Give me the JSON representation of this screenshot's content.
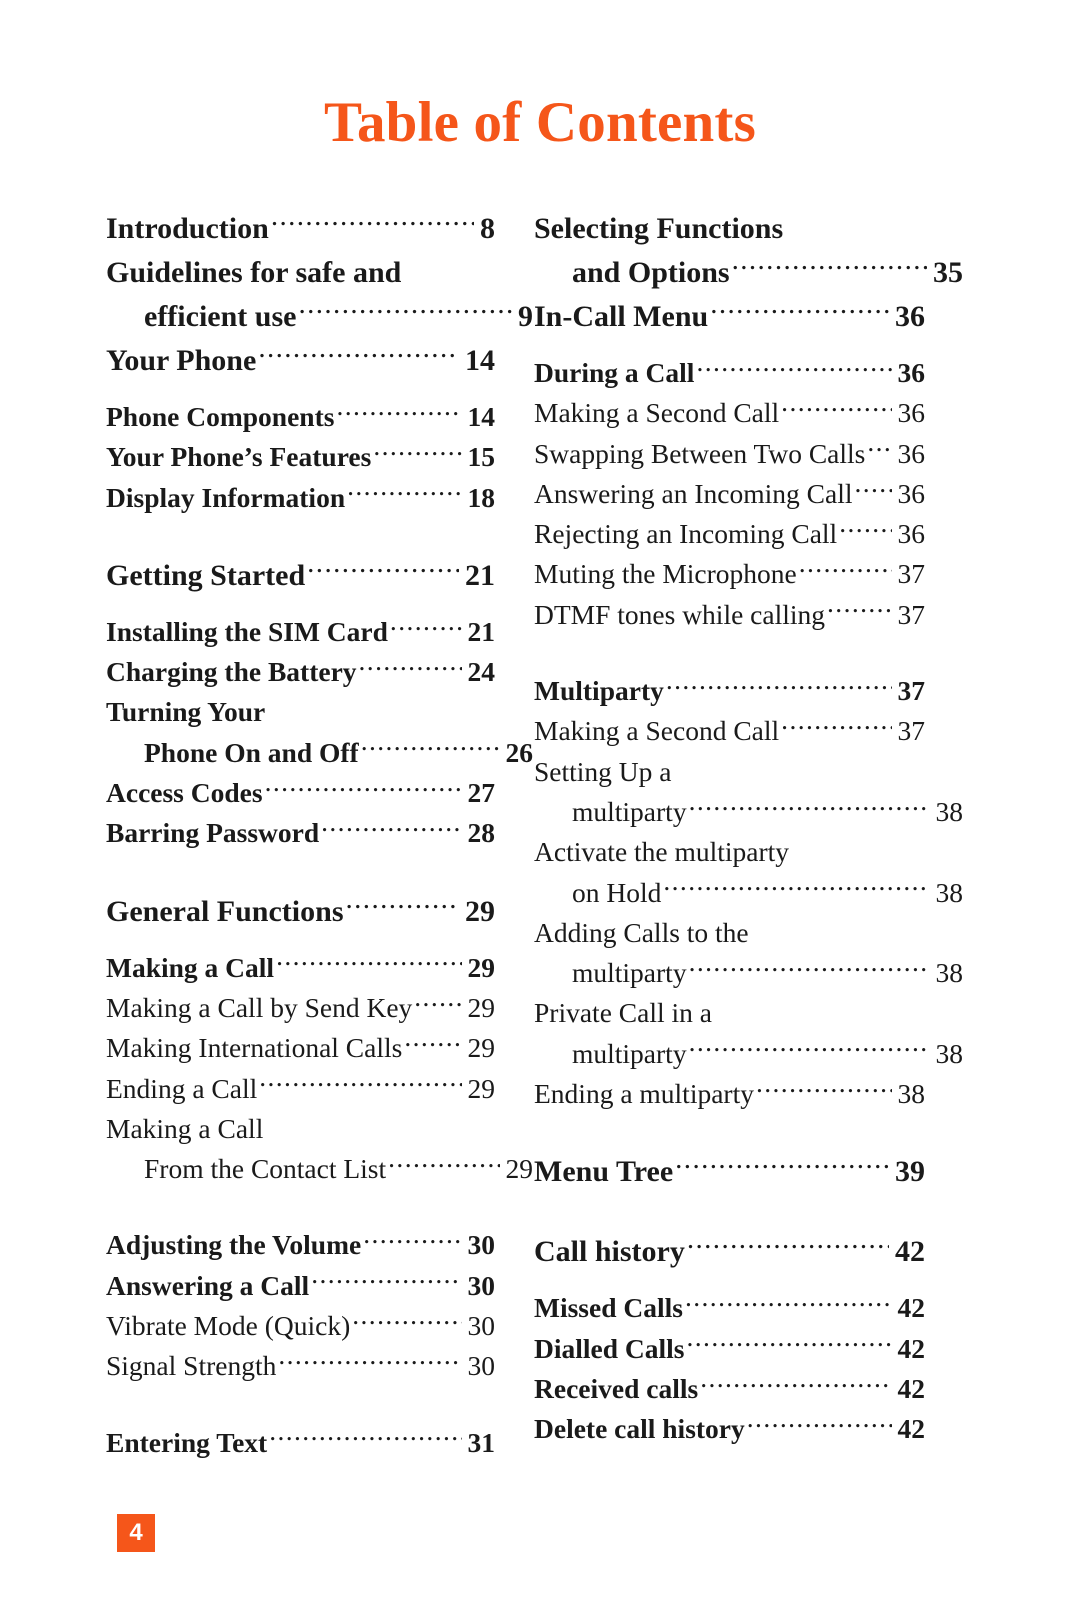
{
  "title": "Table of Contents",
  "accent_color": "#f5561a",
  "text_color": "#1a1a1a",
  "page_badge": {
    "number": "4"
  },
  "left_column": [
    {
      "label": "Introduction",
      "page": "8",
      "style": "head"
    },
    {
      "label": "Guidelines for safe and",
      "page": "",
      "style": "head-noleader"
    },
    {
      "label": "efficient use",
      "page": "9",
      "style": "head-indent"
    },
    {
      "label": "Your Phone",
      "page": "14",
      "style": "head"
    },
    {
      "label": "",
      "page": "",
      "style": "gap-sm"
    },
    {
      "label": "Phone Components",
      "page": "14",
      "style": "bold"
    },
    {
      "label": "Your Phone’s Features",
      "page": "15",
      "style": "bold"
    },
    {
      "label": "Display Information",
      "page": "18",
      "style": "bold"
    },
    {
      "label": "",
      "page": "",
      "style": "gap-lg"
    },
    {
      "label": "Getting Started",
      "page": "21",
      "style": "head"
    },
    {
      "label": "",
      "page": "",
      "style": "gap-sm"
    },
    {
      "label": "Installing the SIM Card",
      "page": "21",
      "style": "bold"
    },
    {
      "label": "Charging the Battery",
      "page": "24",
      "style": "bold"
    },
    {
      "label": "Turning Your",
      "page": "",
      "style": "bold-noleader"
    },
    {
      "label": "Phone On and Off",
      "page": "26",
      "style": "bold-indent"
    },
    {
      "label": "Access Codes",
      "page": "27",
      "style": "bold"
    },
    {
      "label": "Barring Password",
      "page": "28",
      "style": "bold"
    },
    {
      "label": "",
      "page": "",
      "style": "gap-lg"
    },
    {
      "label": "General Functions",
      "page": "29",
      "style": "head"
    },
    {
      "label": "",
      "page": "",
      "style": "gap-sm"
    },
    {
      "label": "Making a Call",
      "page": "29",
      "style": "bold"
    },
    {
      "label": "Making a Call by Send Key",
      "page": "29",
      "style": "regular"
    },
    {
      "label": "Making International Calls",
      "page": "29",
      "style": "regular"
    },
    {
      "label": "Ending a Call",
      "page": "29",
      "style": "regular"
    },
    {
      "label": "Making a Call",
      "page": "",
      "style": "regular-noleader"
    },
    {
      "label": "From the Contact List",
      "page": "29",
      "style": "regular-indent"
    },
    {
      "label": "",
      "page": "",
      "style": "gap-lg"
    },
    {
      "label": "Adjusting the Volume",
      "page": "30",
      "style": "bold"
    },
    {
      "label": "Answering a Call",
      "page": "30",
      "style": "bold"
    },
    {
      "label": "Vibrate Mode (Quick)",
      "page": "30",
      "style": "regular"
    },
    {
      "label": "Signal Strength",
      "page": "30",
      "style": "regular"
    },
    {
      "label": "",
      "page": "",
      "style": "gap-lg"
    },
    {
      "label": "Entering Text",
      "page": "31",
      "style": "bold"
    }
  ],
  "right_column": [
    {
      "label": "Selecting Functions",
      "page": "",
      "style": "head-noleader"
    },
    {
      "label": "and Options",
      "page": "35",
      "style": "head-indent"
    },
    {
      "label": "In-Call Menu",
      "page": "36",
      "style": "head"
    },
    {
      "label": "",
      "page": "",
      "style": "gap-sm"
    },
    {
      "label": "During a Call",
      "page": "36",
      "style": "bold"
    },
    {
      "label": "Making a Second Call",
      "page": "36",
      "style": "regular"
    },
    {
      "label": "Swapping Between Two Calls",
      "page": "36",
      "style": "regular"
    },
    {
      "label": "Answering an Incoming Call",
      "page": "36",
      "style": "regular"
    },
    {
      "label": "Rejecting an Incoming Call",
      "page": "36",
      "style": "regular"
    },
    {
      "label": "Muting the Microphone",
      "page": "37",
      "style": "regular"
    },
    {
      "label": "DTMF tones while calling",
      "page": "37",
      "style": "regular"
    },
    {
      "label": "",
      "page": "",
      "style": "gap-lg"
    },
    {
      "label": "Multiparty",
      "page": "37",
      "style": "bold"
    },
    {
      "label": "Making a Second Call",
      "page": "37",
      "style": "regular"
    },
    {
      "label": "Setting Up a",
      "page": "",
      "style": "regular-noleader"
    },
    {
      "label": "multiparty",
      "page": "38",
      "style": "regular-indent"
    },
    {
      "label": "Activate the multiparty",
      "page": "",
      "style": "regular-noleader"
    },
    {
      "label": "on Hold",
      "page": "38",
      "style": "regular-indent"
    },
    {
      "label": "Adding Calls to the",
      "page": "",
      "style": "regular-noleader"
    },
    {
      "label": "multiparty",
      "page": "38",
      "style": "regular-indent"
    },
    {
      "label": "Private Call in a",
      "page": "",
      "style": "regular-noleader"
    },
    {
      "label": "multiparty",
      "page": "38",
      "style": "regular-indent"
    },
    {
      "label": "Ending a multiparty",
      "page": "38",
      "style": "regular"
    },
    {
      "label": "",
      "page": "",
      "style": "gap-lg"
    },
    {
      "label": "Menu Tree",
      "page": "39",
      "style": "head"
    },
    {
      "label": "",
      "page": "",
      "style": "gap-lg"
    },
    {
      "label": "Call history",
      "page": "42",
      "style": "head"
    },
    {
      "label": "",
      "page": "",
      "style": "gap-sm"
    },
    {
      "label": "Missed Calls",
      "page": "42",
      "style": "bold"
    },
    {
      "label": "Dialled Calls",
      "page": "42",
      "style": "bold"
    },
    {
      "label": "Received calls",
      "page": "42",
      "style": "bold"
    },
    {
      "label": "Delete call history",
      "page": "42",
      "style": "bold"
    }
  ]
}
